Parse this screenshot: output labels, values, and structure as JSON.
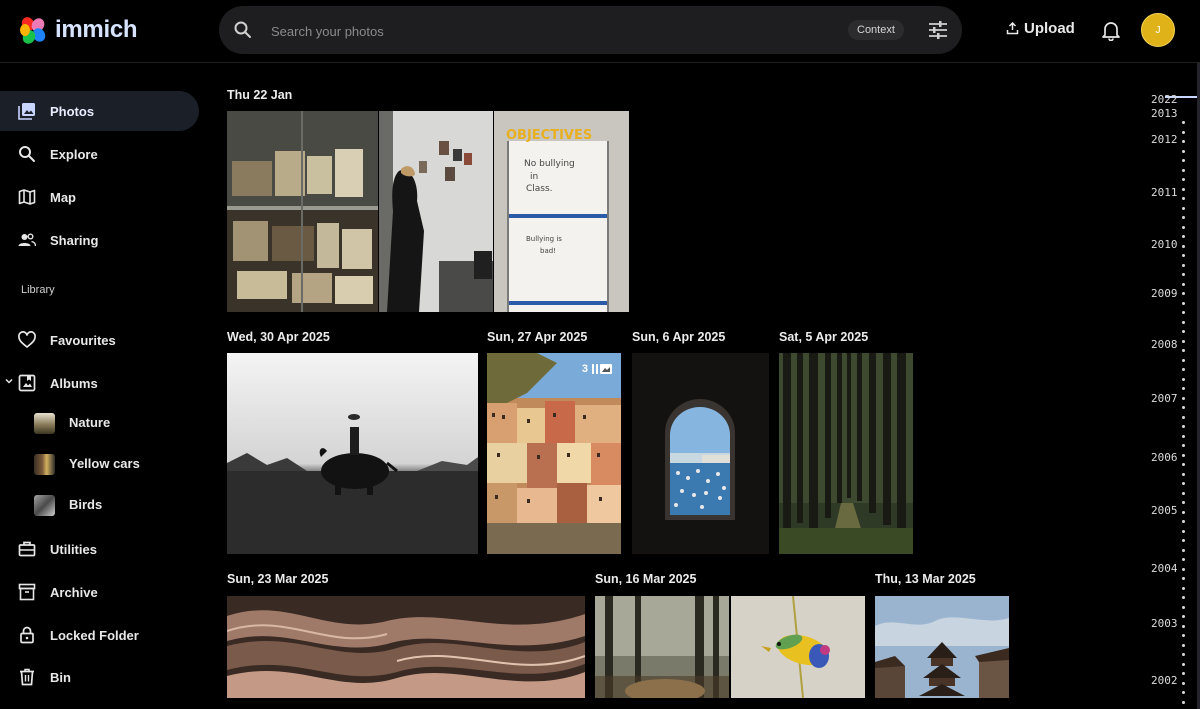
{
  "app": {
    "name": "immich"
  },
  "search": {
    "placeholder": "Search your photos",
    "context_label": "Context"
  },
  "header": {
    "upload_label": "Upload",
    "avatar_initial": "J"
  },
  "sidebar": {
    "items": [
      {
        "label": "Photos",
        "icon": "photos-icon"
      },
      {
        "label": "Explore",
        "icon": "search-icon"
      },
      {
        "label": "Map",
        "icon": "map-icon"
      },
      {
        "label": "Sharing",
        "icon": "people-icon"
      }
    ],
    "library_label": "Library",
    "library_items": [
      {
        "label": "Favourites",
        "icon": "heart-icon"
      },
      {
        "label": "Albums",
        "icon": "album-icon"
      }
    ],
    "albums": [
      {
        "label": "Nature"
      },
      {
        "label": "Yellow cars"
      },
      {
        "label": "Birds"
      }
    ],
    "bottom_items": [
      {
        "label": "Utilities",
        "icon": "toolbox-icon"
      },
      {
        "label": "Archive",
        "icon": "archive-icon"
      },
      {
        "label": "Locked Folder",
        "icon": "lock-icon"
      },
      {
        "label": "Bin",
        "icon": "trash-icon"
      }
    ]
  },
  "timeline": {
    "groups": [
      {
        "date": "Thu 22 Jan"
      },
      {
        "date": "Wed, 30 Apr 2025"
      },
      {
        "date": "Sun, 27 Apr 2025",
        "stack_count": "3"
      },
      {
        "date": "Sun, 6 Apr 2025"
      },
      {
        "date": "Sat, 5 Apr 2025"
      },
      {
        "date": "Sun, 23 Mar 2025"
      },
      {
        "date": "Sun, 16 Mar 2025"
      },
      {
        "date": "Thu, 13 Mar 2025"
      }
    ],
    "whiteboard": {
      "title": "OBJECTIVES",
      "line1": "No bullying",
      "line2": "in",
      "line3": "Class.",
      "line4": "Bullying is",
      "line5": "bad!"
    }
  },
  "scrubber": {
    "years": [
      "2022",
      "2013",
      "2012",
      "2011",
      "2010",
      "2009",
      "2008",
      "2007",
      "2006",
      "2005",
      "2004",
      "2003",
      "2002"
    ]
  },
  "colors": {
    "background": "#000000",
    "avatar": "#e0b21a",
    "active_nav": "#1b1f27",
    "search_bg": "#1e1e20"
  }
}
